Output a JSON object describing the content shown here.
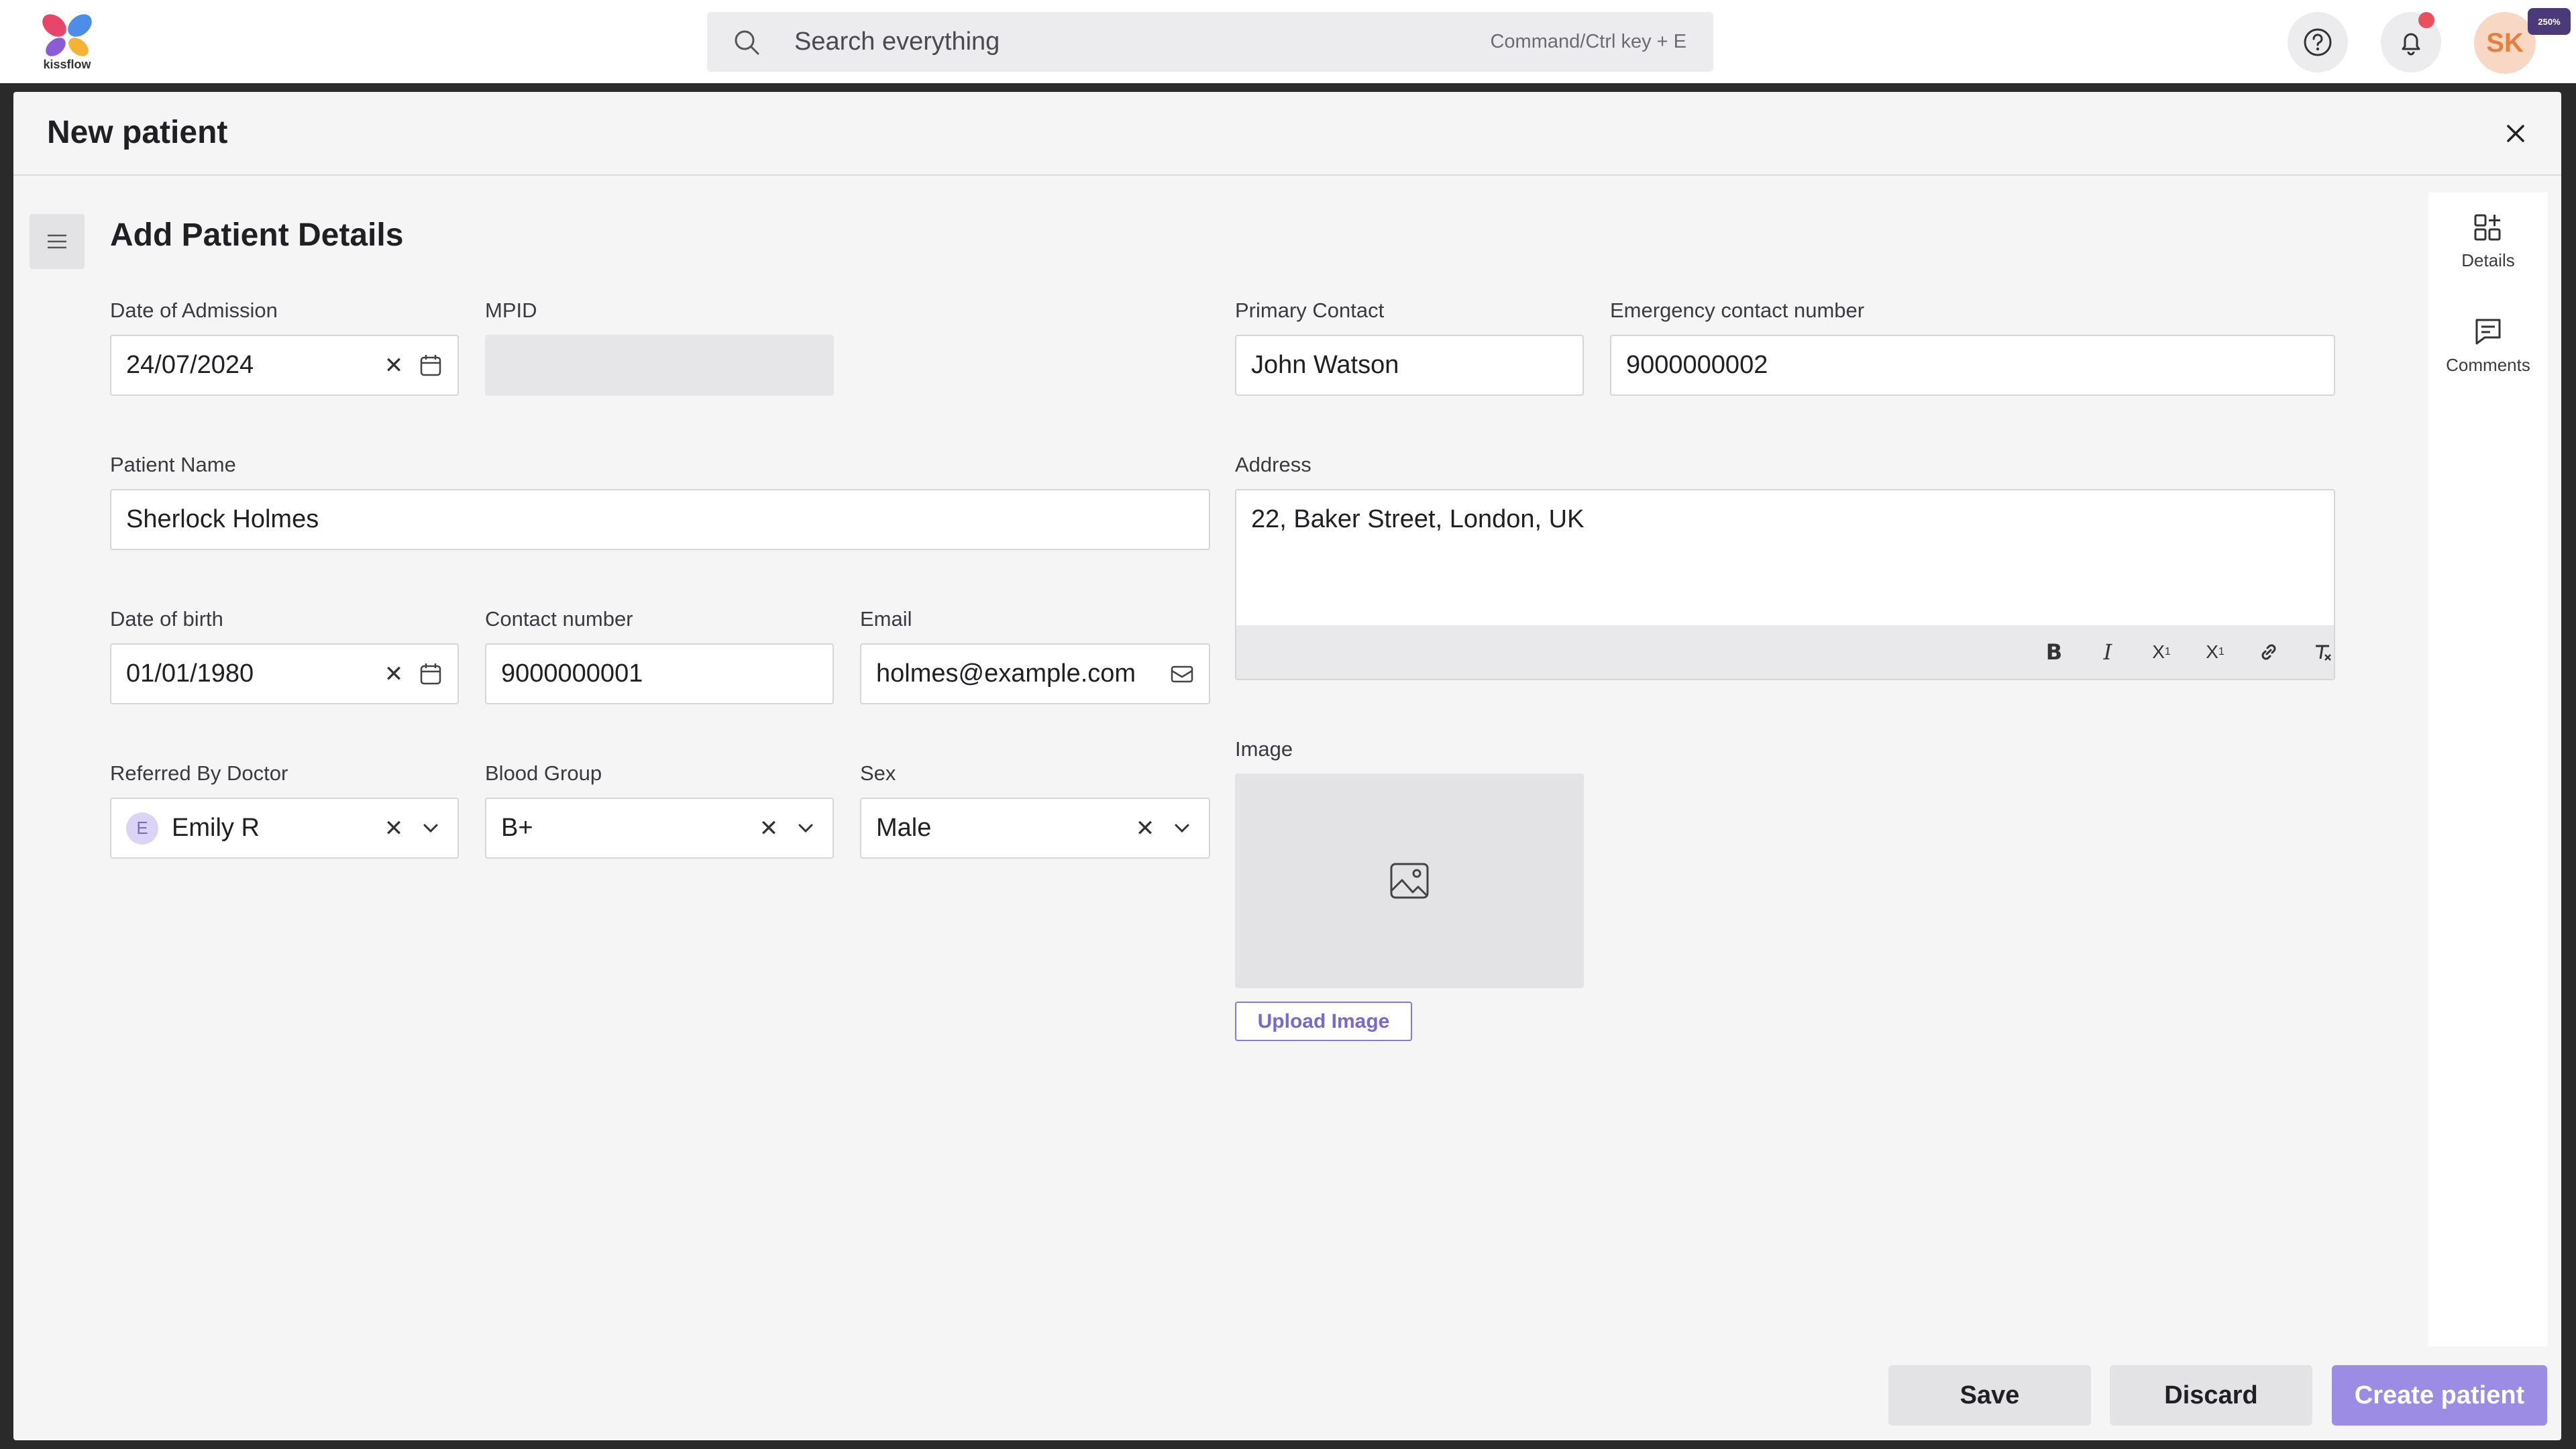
{
  "app": {
    "logo_text": "kissflow"
  },
  "search": {
    "placeholder": "Search everything",
    "shortcut": "Command/Ctrl key + E"
  },
  "user": {
    "initials": "SK",
    "zoom_badge": "250%"
  },
  "modal": {
    "title": "New patient"
  },
  "section": {
    "title": "Add Patient Details"
  },
  "fields": {
    "date_of_admission": {
      "label": "Date of Admission",
      "value": "24/07/2024"
    },
    "mpid": {
      "label": "MPID",
      "value": ""
    },
    "primary_contact": {
      "label": "Primary Contact",
      "value": "John Watson"
    },
    "emergency_contact": {
      "label": "Emergency contact number",
      "value": "9000000002"
    },
    "patient_name": {
      "label": "Patient Name",
      "value": "Sherlock Holmes"
    },
    "address": {
      "label": "Address",
      "value": "22, Baker Street, London, UK"
    },
    "date_of_birth": {
      "label": "Date of birth",
      "value": "01/01/1980"
    },
    "contact_number": {
      "label": "Contact number",
      "value": "9000000001"
    },
    "email": {
      "label": "Email",
      "value": "holmes@example.com"
    },
    "referred_by": {
      "label": "Referred By Doctor",
      "value": "Emily R",
      "avatar_initial": "E"
    },
    "blood_group": {
      "label": "Blood Group",
      "value": "B+"
    },
    "sex": {
      "label": "Sex",
      "value": "Male"
    },
    "image": {
      "label": "Image",
      "upload_label": "Upload Image"
    }
  },
  "rte_toolbar": [
    "bold-icon",
    "italic-icon",
    "subscript-icon",
    "superscript-icon",
    "link-icon",
    "clear-format-icon"
  ],
  "side_panel": {
    "details_label": "Details",
    "comments_label": "Comments"
  },
  "footer": {
    "save_label": "Save",
    "discard_label": "Discard",
    "create_label": "Create patient"
  },
  "colors": {
    "primary": "#9d8ce4",
    "accent_text": "#7a68cf",
    "notification": "#e8505b",
    "avatar_bg": "#f8d8c4"
  }
}
